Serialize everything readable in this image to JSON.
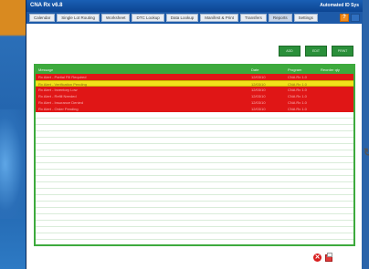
{
  "window": {
    "title": "CNA Rx v6.8",
    "brand": "Automated ID Sys"
  },
  "menu": {
    "items": [
      {
        "label": "Calendar"
      },
      {
        "label": "Single Lot Routing"
      },
      {
        "label": "Worksheet"
      },
      {
        "label": "DTC Lookup"
      },
      {
        "label": "Data Lookup"
      },
      {
        "label": "Manifest & Print"
      },
      {
        "label": "Transfers"
      },
      {
        "label": "Reports"
      },
      {
        "label": "Settings"
      }
    ],
    "active_index": 7,
    "orange_label": "?"
  },
  "actions": [
    {
      "label": "ADD"
    },
    {
      "label": "EDIT"
    },
    {
      "label": "PRINT"
    }
  ],
  "table": {
    "columns": [
      "Message",
      "Date",
      "Program",
      "Reorder qty"
    ],
    "rows": [
      {
        "status": "red",
        "message": "Rx Alert  - Partial Fill Required",
        "date": "12/03/10",
        "program": "CNA Rx 1.0",
        "qty": ""
      },
      {
        "status": "yellow",
        "message": "Rx Alert  -  Verification  Pending",
        "date": "12/03/10",
        "program": "CNA Rx 1.0",
        "qty": ""
      },
      {
        "status": "red",
        "message": "Rx Alert  - Inventory Low",
        "date": "12/03/10",
        "program": "CNA Rx 1.0",
        "qty": ""
      },
      {
        "status": "red",
        "message": "Rx Alert  - Refill Needed",
        "date": "12/03/10",
        "program": "CNA Rx 1.0",
        "qty": ""
      },
      {
        "status": "red",
        "message": "Rx Alert  - Insurance Denied",
        "date": "12/03/10",
        "program": "CNA Rx 1.0",
        "qty": ""
      },
      {
        "status": "red",
        "message": "Rx Alert  - Order Pending",
        "date": "12/03/10",
        "program": "CNA Rx 1.0",
        "qty": ""
      }
    ],
    "empty_rows": 20
  },
  "colors": {
    "accent_green": "#3daa3d",
    "alert_red": "#e01616",
    "alert_yellow": "#f2e21a",
    "titlebar_blue": "#1a5fb4"
  },
  "icons": {
    "spinner": "refresh-icon",
    "close": "close-icon",
    "print": "print-icon"
  }
}
